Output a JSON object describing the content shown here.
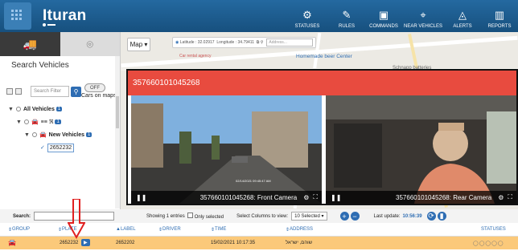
{
  "app": {
    "title": "Ituran"
  },
  "nav": [
    {
      "label": "STATUSES",
      "icon": "statuses-icon"
    },
    {
      "label": "RULES",
      "icon": "rules-icon"
    },
    {
      "label": "COMMANDS",
      "icon": "commands-icon"
    },
    {
      "label": "NEAR VEHICLES",
      "icon": "near-vehicles-icon"
    },
    {
      "label": "ALERTS",
      "icon": "alerts-icon"
    },
    {
      "label": "REPORTS",
      "icon": "reports-icon"
    }
  ],
  "sidebar": {
    "search_title": "Search Vehicles",
    "filter_placeholder": "Search Filter",
    "toggle_label": "OFF",
    "cars_on_maps": "Cars on maps",
    "tree": {
      "all_vehicles": "All Vehicles",
      "all_count": "1",
      "group_count": "1",
      "new_vehicles": "New Vehicles",
      "new_count": "1",
      "plate": "2652232"
    }
  },
  "map": {
    "mode_label": "Map",
    "latitude_label": "Latitude : 32.02917",
    "longitude_label": "Longitude : 34.79411",
    "address_placeholder": "Address...",
    "poi_1": "Homemade beer Center",
    "poi_2": "Car rental agency",
    "poi_3": "Schnapp batteries"
  },
  "video": {
    "device_id": "357660101045268",
    "front_label": "357660101045268: Front Camera",
    "rear_label": "357660101045268: Rear Camera",
    "front_stamp": "02/14/2021 09:45:47 AM"
  },
  "table": {
    "search_label": "Search:",
    "showing_text": "Showing 1 entries",
    "only_selected": "Only selected",
    "select_columns": "Select Columns to view:",
    "selected_count": "10 Selected",
    "last_update_label": "Last update:",
    "last_update_time": "10:56:39",
    "columns": {
      "group": "GROUP",
      "plate": "PLATE",
      "label": "LABEL",
      "driver": "DRIVER",
      "time": "TIME",
      "address": "ADDRESS",
      "statuses": "STATUSES"
    },
    "rows": [
      {
        "plate": "2652232",
        "label": "2652202",
        "driver": "",
        "time": "15/02/2021 10:17:35",
        "address": "שוהם, ישראל"
      }
    ]
  },
  "colors": {
    "header": "#1d5f93",
    "dialog_header": "#e84b3f",
    "row_highlight": "#fbc97a",
    "accent": "#2e6db3"
  }
}
